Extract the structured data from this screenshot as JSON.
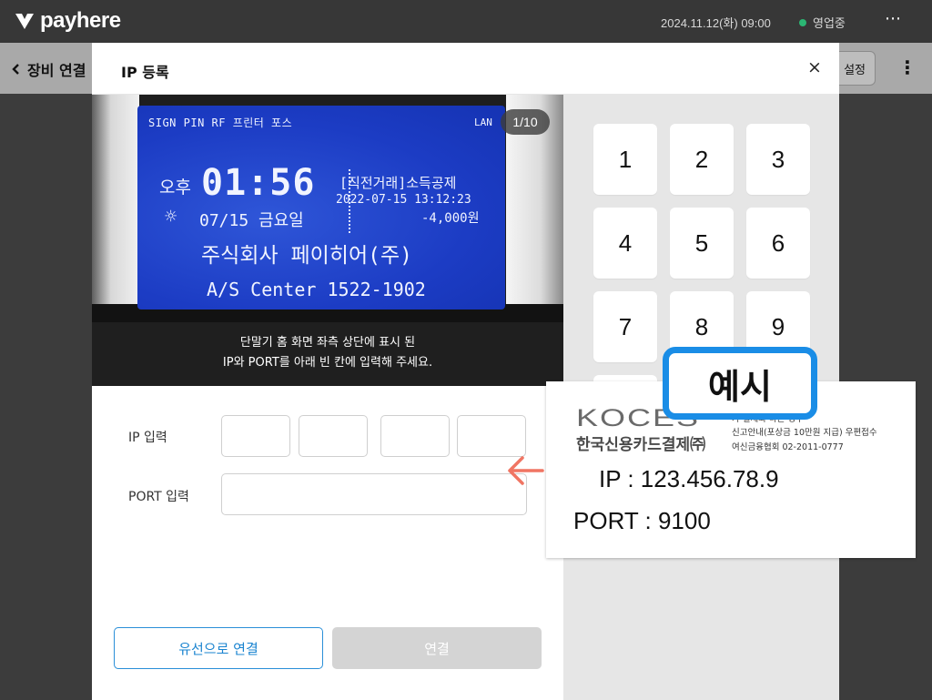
{
  "app": {
    "name": "payhere"
  },
  "topbar": {
    "datetime": "2024.11.12(화) 09:00",
    "status": "영업중",
    "more_icon": "⋯"
  },
  "subbar": {
    "back_label": "장비 연결",
    "settings_label": "설정",
    "more_icon": "⋮"
  },
  "modal": {
    "title": "IP 등록",
    "close_icon": "×",
    "page_indicator": "1/10",
    "lcd": {
      "top_left": "SIGN PIN RF 프린터 포스",
      "top_right": "LAN",
      "ampm": "오후",
      "time": "01:56",
      "date": "07/15 금요일",
      "tx_title": "[직전거래]소득공제",
      "tx_datetime": "2022-07-15 13:12:23",
      "tx_amount": "-4,000원",
      "company": "주식회사 페이히어(주)",
      "as_center": "A/S Center 1522-1902"
    },
    "instruction_line1": "단말기 홈 화면 좌측 상단에 표시 된",
    "instruction_line2": "IP와 PORT를 아래 빈 칸에 입력해 주세요.",
    "ip_label": "IP 입력",
    "port_label": "PORT 입력",
    "ip_fields": [
      "",
      "",
      "",
      ""
    ],
    "port_value": "",
    "wired_button": "유선으로 연결",
    "connect_button": "연결",
    "keypad": [
      "1",
      "2",
      "3",
      "4",
      "5",
      "6",
      "7",
      "8",
      "9"
    ]
  },
  "example": {
    "badge": "예시",
    "brand": "KOCES",
    "brand_sub": "한국신용카드결제㈜",
    "notice_line1": "가 실제와 다른 경우",
    "notice_line2": "신고안내(포상금 10만원 지급) 우편접수",
    "notice_line3": "여신금융협회 02-2011-0777",
    "ip_line": "IP   :   123.456.78.9",
    "port_line": "PORT :   9100"
  },
  "colors": {
    "accent": "#1a8de6",
    "status_green": "#2bb673",
    "arrow": "#f07563"
  }
}
